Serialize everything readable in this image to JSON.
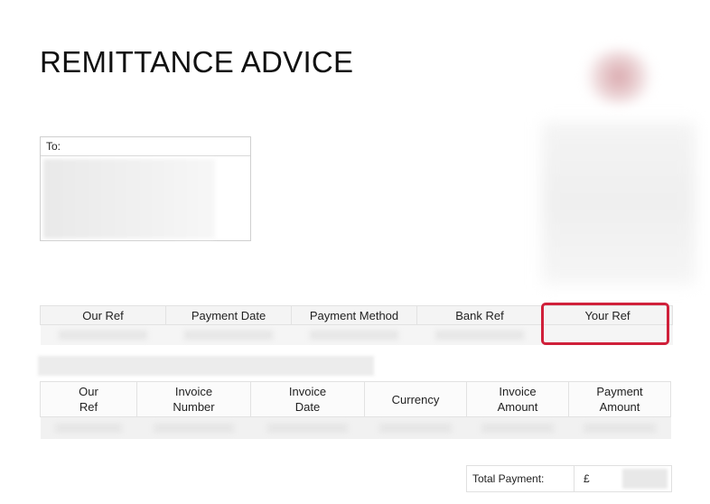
{
  "document": {
    "title": "REMITTANCE ADVICE",
    "to_label": "To:"
  },
  "ref_table": {
    "headers": [
      "Our Ref",
      "Payment Date",
      "Payment Method",
      "Bank Ref",
      "Your Ref"
    ]
  },
  "invoice_table": {
    "headers": [
      [
        "Our",
        "Ref"
      ],
      [
        "Invoice",
        "Number"
      ],
      [
        "Invoice",
        "Date"
      ],
      [
        "Currency"
      ],
      [
        "Invoice",
        "Amount"
      ],
      [
        "Payment",
        "Amount"
      ]
    ]
  },
  "totals": {
    "label": "Total Payment:",
    "currency": "£"
  },
  "colors": {
    "highlight": "#d0203a"
  }
}
